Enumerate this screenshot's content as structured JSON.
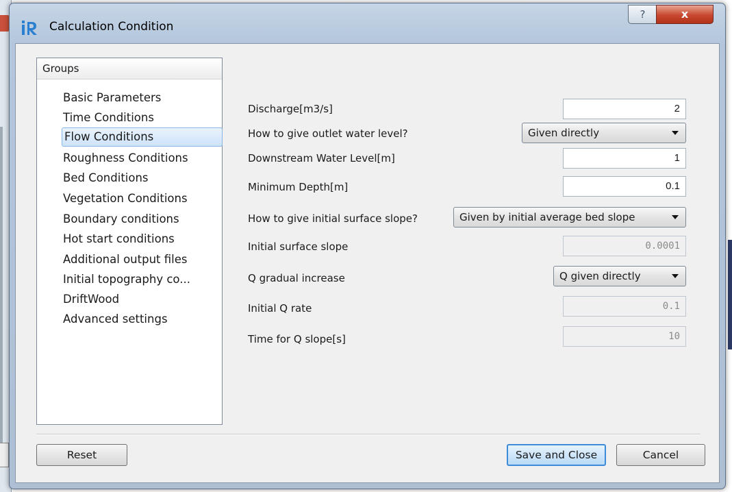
{
  "window": {
    "title": "Calculation Condition",
    "help_label": "?",
    "close_label": "x",
    "app_icon": "iric-logo-icon"
  },
  "groups": {
    "header": "Groups",
    "items": [
      {
        "label": "Basic Parameters"
      },
      {
        "label": "Time Conditions"
      },
      {
        "label": "Flow Conditions",
        "selected": true
      },
      {
        "label": "Roughness Conditions"
      },
      {
        "label": "Bed Conditions"
      },
      {
        "label": "Vegetation Conditions"
      },
      {
        "label": "Boundary conditions"
      },
      {
        "label": "Hot start conditions"
      },
      {
        "label": "Additional output files"
      },
      {
        "label": "Initial topography co..."
      },
      {
        "label": "DriftWood"
      },
      {
        "label": "Advanced settings"
      }
    ]
  },
  "form": {
    "discharge": {
      "label": "Discharge[m3/s]",
      "value": "2"
    },
    "outlet_level_method": {
      "label": "How to give outlet water level?",
      "value": "Given directly"
    },
    "downstream_level": {
      "label": "Downstream Water Level[m]",
      "value": "1"
    },
    "minimum_depth": {
      "label": "Minimum Depth[m]",
      "value": "0.1"
    },
    "initial_slope_method": {
      "label": "How to give initial surface slope?",
      "value": "Given by initial average bed slope"
    },
    "initial_surface_slope": {
      "label": "Initial surface slope",
      "value": "0.0001"
    },
    "q_gradual_increase": {
      "label": "Q gradual increase",
      "value": "Q given directly"
    },
    "initial_q_rate": {
      "label": "Initial Q rate",
      "value": "0.1"
    },
    "time_for_q_slope": {
      "label": "Time for Q slope[s]",
      "value": "10"
    }
  },
  "buttons": {
    "reset": "Reset",
    "save_close": "Save and Close",
    "cancel": "Cancel"
  },
  "colors": {
    "selection_border": "#88b6e6",
    "default_button_border": "#3c8bd9",
    "close_button": "#c7482f"
  }
}
